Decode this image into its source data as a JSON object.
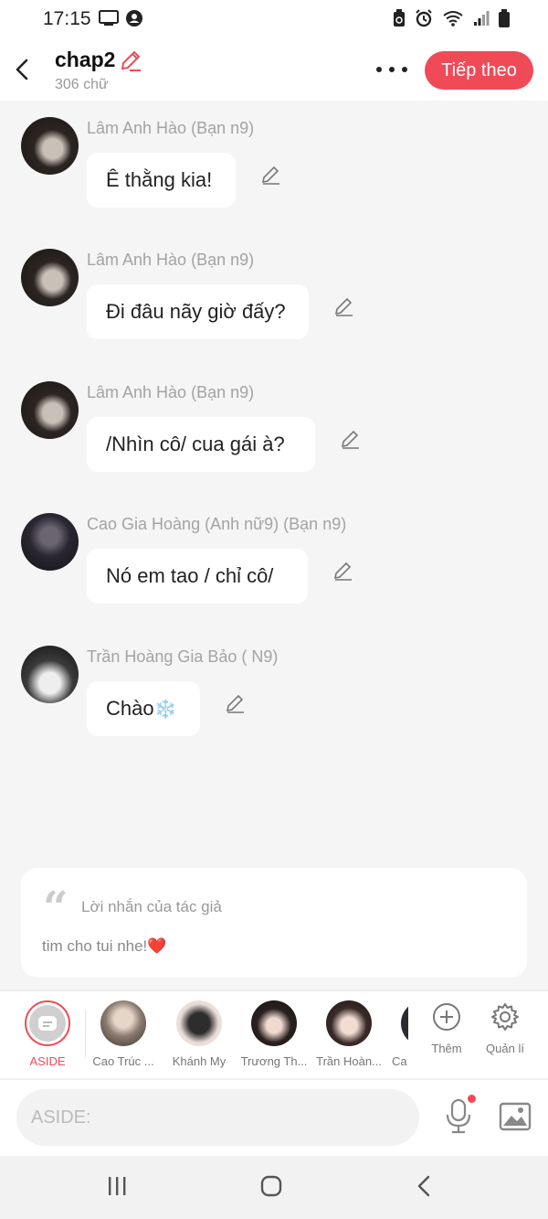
{
  "status_bar": {
    "time": "17:15"
  },
  "header": {
    "title": "chap2",
    "word_count": "306 chữ",
    "next_label": "Tiếp theo"
  },
  "messages": [
    {
      "sender": "Lâm Anh Hào (Bạn n9)",
      "text": "Ê thằng kia!"
    },
    {
      "sender": "Lâm Anh Hào (Bạn n9)",
      "text": "Đi đâu nãy giờ đấy?"
    },
    {
      "sender": "Lâm Anh Hào (Bạn n9)",
      "text": "/Nhìn cô/ cua gái à?"
    },
    {
      "sender": "Cao Gia Hoàng (Anh nữ9) (Bạn n9)",
      "text": "Nó em tao / chỉ cô/"
    },
    {
      "sender": "Trần Hoàng Gia Bảo ( N9)",
      "text": "Chào",
      "emoji": "❄️"
    }
  ],
  "author_note": {
    "label": "Lời nhắn của tác giả",
    "text": "tim cho tui nhe!",
    "heart": "❤️"
  },
  "characters": {
    "aside_label": "ASIDE",
    "items": [
      {
        "name": "Cao Trúc ..."
      },
      {
        "name": "Khánh My"
      },
      {
        "name": "Trương Th..."
      },
      {
        "name": "Trần Hoàn..."
      },
      {
        "name": "Ca"
      }
    ],
    "add_label": "Thêm",
    "manage_label": "Quản lí"
  },
  "input": {
    "placeholder": "ASIDE:"
  },
  "colors": {
    "accent": "#f04a57",
    "background": "#f5f5f6"
  }
}
